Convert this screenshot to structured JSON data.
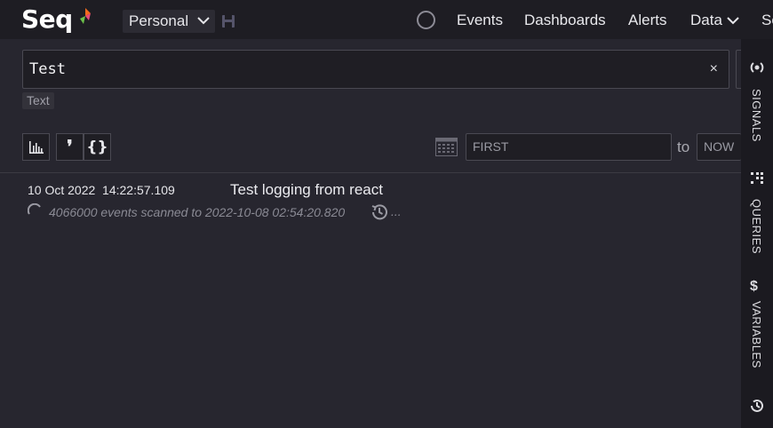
{
  "app": {
    "logo_text": "Seq",
    "workspace": "Personal"
  },
  "nav": {
    "items": [
      "Events",
      "Dashboards",
      "Alerts",
      "Data",
      "Se"
    ]
  },
  "search": {
    "value": "Test",
    "clear_glyph": "×",
    "filter_chip": "Text"
  },
  "toolbar": {
    "chart_icon": "bar-chart-icon",
    "quote_label": "❜",
    "json_label": "{}",
    "calendar_icon": "calendar-icon",
    "from_placeholder": "FIRST",
    "to_label": "to",
    "to_placeholder": "NOW"
  },
  "events": [
    {
      "timestamp": "10 Oct 2022  14:22:57.109",
      "message": "Test logging from react"
    }
  ],
  "status": {
    "text": "4066000 events scanned to 2022-10-08 02:54:20.820",
    "ellipsis": "..."
  },
  "sidebar": {
    "items": [
      {
        "label": "SIGNALS",
        "icon": "signals-icon"
      },
      {
        "label": "QUERIES",
        "icon": "queries-icon"
      },
      {
        "label": "VARIABLES",
        "icon": "variables-icon"
      },
      {
        "label": "",
        "icon": "history-icon"
      }
    ]
  },
  "colors": {
    "background": "#27262f",
    "topbar": "#1e1d23",
    "sidebar": "#1b1a20",
    "logo_accent_orange": "#f26b1d",
    "logo_accent_green": "#6cc04a"
  }
}
